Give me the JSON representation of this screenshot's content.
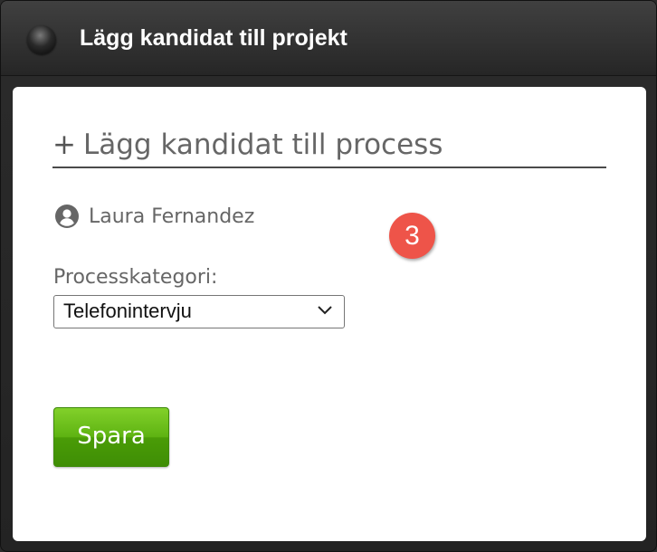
{
  "dialog": {
    "title": "Lägg kandidat till projekt"
  },
  "form": {
    "heading_icon": "+",
    "heading": "Lägg kandidat till process",
    "candidate": {
      "icon": "user-circle-icon",
      "name": "Laura Fernandez"
    },
    "step_badge": "3",
    "category_label": "Processkategori:",
    "category_select": {
      "selected": "Telefonintervju"
    },
    "save_label": "Spara"
  },
  "colors": {
    "badge": "#ee5449",
    "save_button": "#5eb312",
    "titlebar": "#333333"
  }
}
